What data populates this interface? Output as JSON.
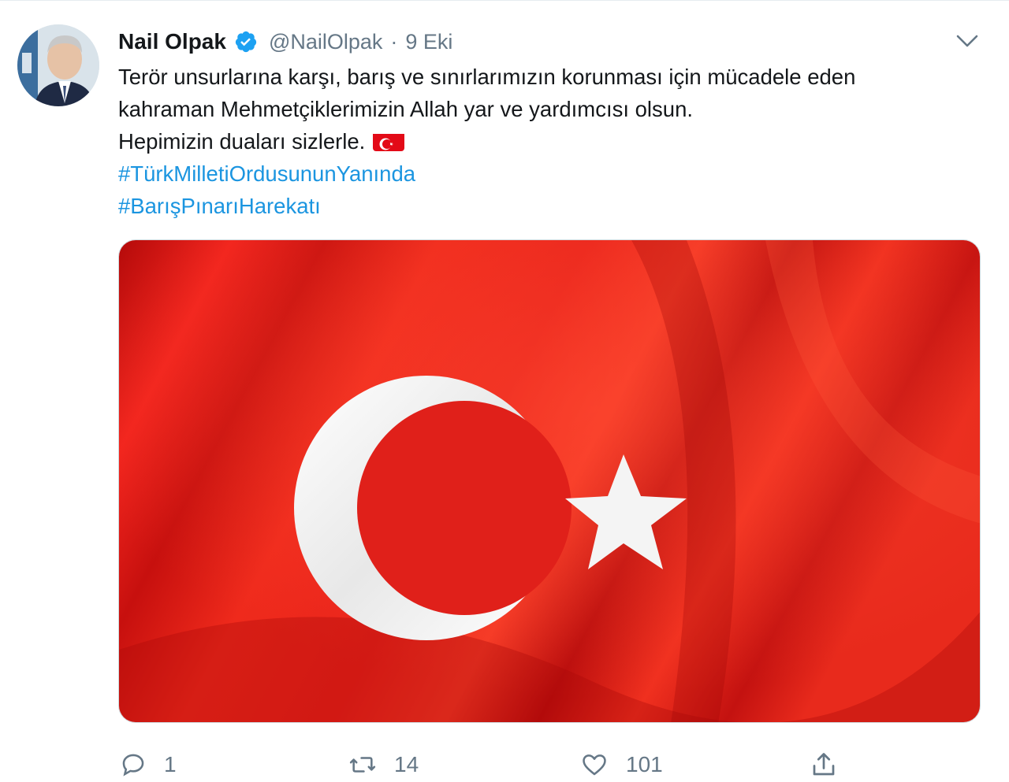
{
  "tweet": {
    "author": {
      "display_name": "Nail Olpak",
      "verified": true,
      "handle": "@NailOlpak",
      "separator": "·",
      "time": "9 Eki"
    },
    "text_lines": [
      "Terör unsurlarına karşı, barış ve sınırlarımızın korunması için mücadele eden",
      "kahraman Mehmetçiklerimizin Allah yar ve yardımcısı olsun.",
      "Hepimizin duaları sizlerle."
    ],
    "emoji": "turkey-flag",
    "hashtags": [
      "#TürkMilletiOrdusununYanında",
      "#BarışPınarıHarekatı"
    ],
    "media": {
      "subject": "turkish-flag-waving"
    },
    "actions": {
      "reply_count": "1",
      "retweet_count": "14",
      "like_count": "101"
    }
  },
  "colors": {
    "text": "#14171a",
    "secondary_text": "#657786",
    "link": "#1b95e0",
    "verified": "#1da1f2",
    "flag_red": "#e30a17"
  },
  "icons": {
    "verified": "verified-badge-icon",
    "menu": "chevron-down-icon",
    "reply": "reply-icon",
    "retweet": "retweet-icon",
    "like": "heart-icon",
    "share": "share-icon"
  }
}
